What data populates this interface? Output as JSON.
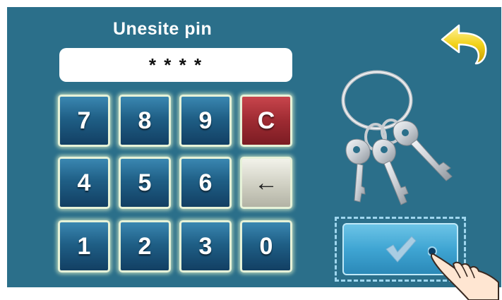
{
  "dialog": {
    "title": "Unesite pin",
    "pin_display": "* * * *"
  },
  "keypad": {
    "rows": [
      [
        "7",
        "8",
        "9",
        "C"
      ],
      [
        "4",
        "5",
        "6",
        "←"
      ],
      [
        "1",
        "2",
        "3",
        "0"
      ]
    ]
  },
  "icons": {
    "back": "back-arrow-icon",
    "illustration": "keys-icon",
    "confirm": "checkmark-icon",
    "pointer": "hand-pointer-icon"
  },
  "colors": {
    "background": "#2b6f8a",
    "key_blue": "#1f5f86",
    "key_clear": "#9e2b32",
    "key_backspace": "#cfcfc2",
    "confirm_button": "#3fa5d3",
    "back_arrow": "#f0d020"
  }
}
